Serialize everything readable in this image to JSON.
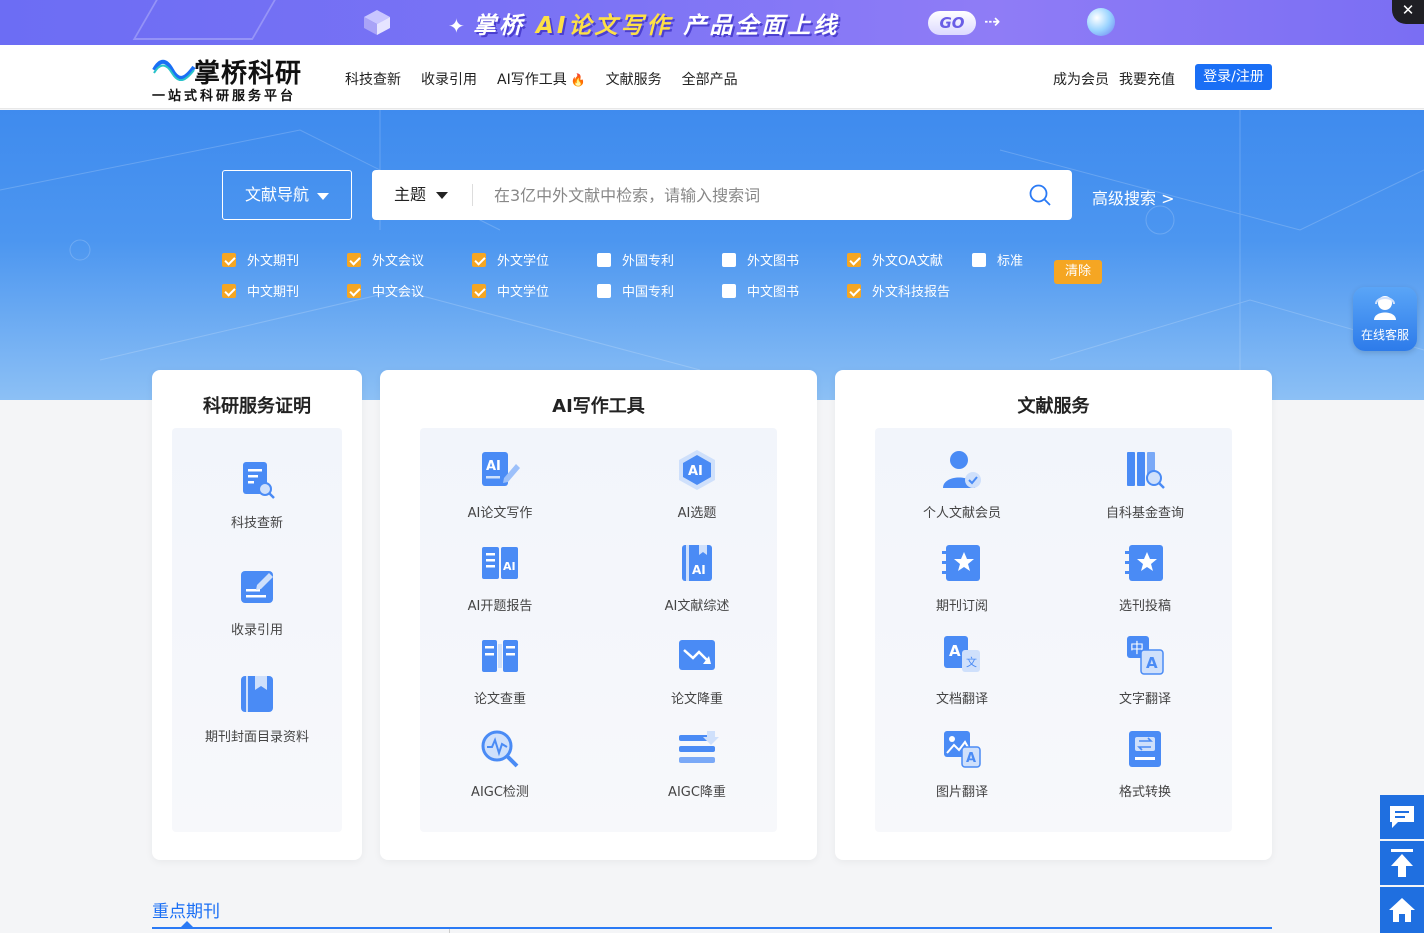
{
  "banner": {
    "brand": "掌桥",
    "highlight": "AI论文写作",
    "suffix": "产品全面上线",
    "go_label": "GO",
    "close_label": "✕"
  },
  "header": {
    "logo_name": "掌桥科研",
    "logo_slogan": "一站式科研服务平台",
    "nav": [
      "科技查新",
      "收录引用",
      "AI写作工具",
      "文献服务",
      "全部产品"
    ],
    "member_label": "成为会员",
    "recharge_label": "我要充值",
    "login_label": "登录/注册"
  },
  "search": {
    "nav_select_label": "文献导航",
    "type_label": "主题",
    "placeholder": "在3亿中外文献中检索，请输入搜索词",
    "advanced_label": "高级搜索 >",
    "clear_label": "清除",
    "filters_row1": [
      {
        "label": "外文期刊",
        "checked": true
      },
      {
        "label": "外文会议",
        "checked": true
      },
      {
        "label": "外文学位",
        "checked": true
      },
      {
        "label": "外国专利",
        "checked": false
      },
      {
        "label": "外文图书",
        "checked": false
      },
      {
        "label": "外文OA文献",
        "checked": true
      },
      {
        "label": "标准",
        "checked": false
      }
    ],
    "filters_row2": [
      {
        "label": "中文期刊",
        "checked": true
      },
      {
        "label": "中文会议",
        "checked": true
      },
      {
        "label": "中文学位",
        "checked": true
      },
      {
        "label": "中国专利",
        "checked": false
      },
      {
        "label": "中文图书",
        "checked": false
      },
      {
        "label": "外文科技报告",
        "checked": true
      }
    ]
  },
  "panels": {
    "research": {
      "title": "科研服务证明",
      "items": [
        "科技查新",
        "收录引用",
        "期刊封面目录资料"
      ]
    },
    "ai_tools": {
      "title": "AI写作工具",
      "items": [
        "AI论文写作",
        "AI选题",
        "AI开题报告",
        "AI文献综述",
        "论文查重",
        "论文降重",
        "AIGC检测",
        "AIGC降重"
      ]
    },
    "literature": {
      "title": "文献服务",
      "items": [
        "个人文献会员",
        "自科基金查询",
        "期刊订阅",
        "选刊投稿",
        "文档翻译",
        "文字翻译",
        "图片翻译",
        "格式转换"
      ]
    }
  },
  "bottom": {
    "key_journals": "重点期刊"
  },
  "float": {
    "online_service": "在线客服"
  },
  "colors": {
    "primary": "#1a6ff5",
    "checkbox_on": "#f5a623",
    "icon_blue": "#3b82f6"
  }
}
